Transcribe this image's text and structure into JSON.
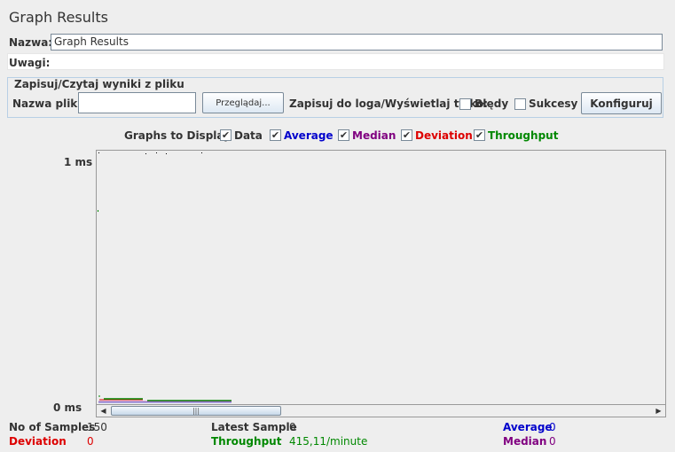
{
  "window": {
    "title": "Graph Results"
  },
  "name_row": {
    "label": "Nazwa:",
    "value": "Graph Results"
  },
  "comments_row": {
    "label": "Uwagi:"
  },
  "file_group": {
    "title": "Zapisuj/Czytaj wyniki z pliku",
    "filename_label": "Nazwa pliku",
    "filename_value": "",
    "browse_label": "Przeglądaj...",
    "log_label": "Zapisuj do loga/Wyświetlaj tylko:",
    "errors_label": "Błędy",
    "errors_checked": false,
    "success_label": "Sukcesy",
    "success_checked": false,
    "configure_label": "Konfiguruj"
  },
  "graphs": {
    "label": "Graphs to Display",
    "items": [
      {
        "label": "Data",
        "checked": true,
        "color": "#000000"
      },
      {
        "label": "Average",
        "checked": true,
        "color": "#0000cc"
      },
      {
        "label": "Median",
        "checked": true,
        "color": "#800080"
      },
      {
        "label": "Deviation",
        "checked": true,
        "color": "#dd0000"
      },
      {
        "label": "Throughput",
        "checked": true,
        "color": "#008800"
      }
    ],
    "check_glyph": "✔"
  },
  "plot": {
    "y_max_label": "1 ms",
    "y_min_label": "0 ms"
  },
  "scrollbar": {
    "left_glyph": "◀",
    "right_glyph": "▶",
    "thumb_glyph": "|||"
  },
  "stats": {
    "no_of_samples_label": "No of Samples",
    "no_of_samples_value": "150",
    "deviation_label": "Deviation",
    "deviation_value": "0",
    "latest_sample_label": "Latest Sample",
    "latest_sample_value": "0",
    "throughput_label": "Throughput",
    "throughput_value": "415,11/minute",
    "average_label": "Average",
    "average_value": "0",
    "median_label": "Median",
    "median_value": "0"
  },
  "colors": {
    "data": "#000000",
    "average": "#0000cc",
    "median": "#800080",
    "deviation": "#dd0000",
    "throughput": "#008800"
  }
}
